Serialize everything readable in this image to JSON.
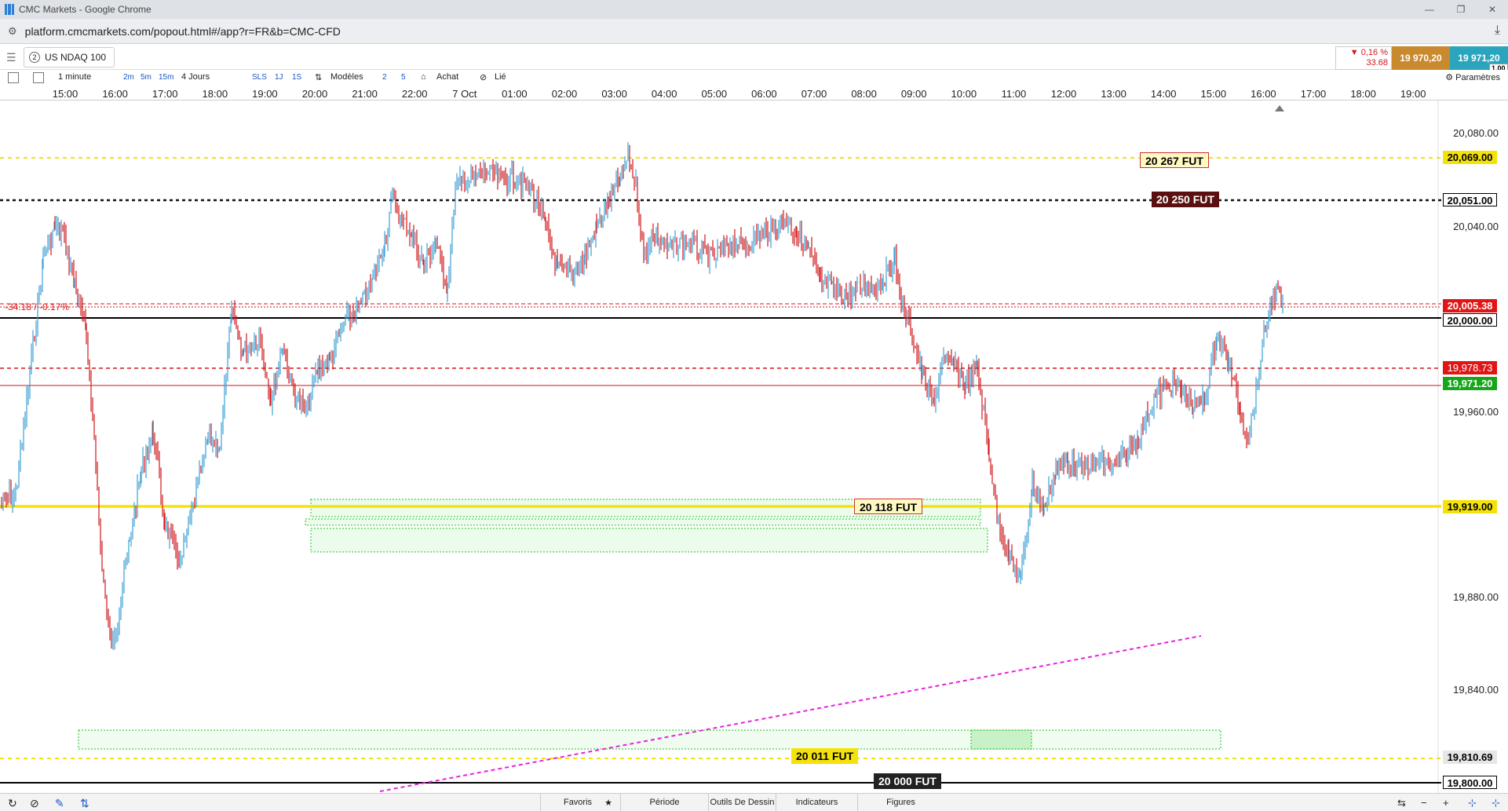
{
  "browser": {
    "window_title": "CMC Markets - Google Chrome",
    "url": "platform.cmcmarkets.com/popout.html#/app?r=FR&b=CMC-CFD"
  },
  "toolbar": {
    "instrument_number": "2",
    "instrument": "US NDAQ 100",
    "change_pct": "▼ 0,16 %",
    "change_pts": "33.68",
    "sell": "19 970,20",
    "buy": "19 971,20",
    "spread": "1.00",
    "timeframe": "1 minute",
    "tf_2m": "2m",
    "tf_5m": "5m",
    "tf_15m": "15m",
    "period": "4 Jours",
    "sls": "SLS",
    "one_j": "1J",
    "one_s": "1S",
    "templates": "Modèles",
    "num2": "2",
    "num5": "5",
    "buy_label": "Achat",
    "linked": "Lié",
    "settings": "Paramètres"
  },
  "time_axis": [
    "15:00",
    "16:00",
    "17:00",
    "18:00",
    "19:00",
    "20:00",
    "21:00",
    "22:00",
    "7 Oct",
    "01:00",
    "02:00",
    "03:00",
    "04:00",
    "05:00",
    "06:00",
    "07:00",
    "08:00",
    "09:00",
    "10:00",
    "11:00",
    "12:00",
    "13:00",
    "14:00",
    "15:00",
    "16:00",
    "17:00",
    "18:00",
    "19:00"
  ],
  "price_axis": [
    "20,080.00",
    "20,040.00",
    "19,960.00",
    "19,880.00",
    "19,840.00"
  ],
  "price_tags": {
    "yellow_top": "20,069.00",
    "black_dotted": "20,051.00",
    "red_level": "20,005.38",
    "black_solid": "20,000.00",
    "red_dashed": "19,978.73",
    "current": "19,971.20",
    "yellow_mid": "19,919.00",
    "yellow_bottom": "19,810.69",
    "black_bottom": "19,800.00"
  },
  "futures_labels": {
    "f20267": "20 267 FUT",
    "f20250": "20 250 FUT",
    "f20118": "20 118 FUT",
    "f20011": "20 011 FUT",
    "f20000": "20 000 FUT"
  },
  "change_annotation": "-34.18 / -0.17%",
  "bottom_bar": {
    "favorites": "Favoris",
    "period": "Période",
    "drawing_tools": "Outils De Dessin",
    "indicators": "Indicateurs",
    "figures": "Figures"
  },
  "colors": {
    "up": "#3d9fd6",
    "down": "#d0161a",
    "yellow": "#f5e20a",
    "green_zone": "#20c020",
    "magenta": "#e820e0"
  }
}
